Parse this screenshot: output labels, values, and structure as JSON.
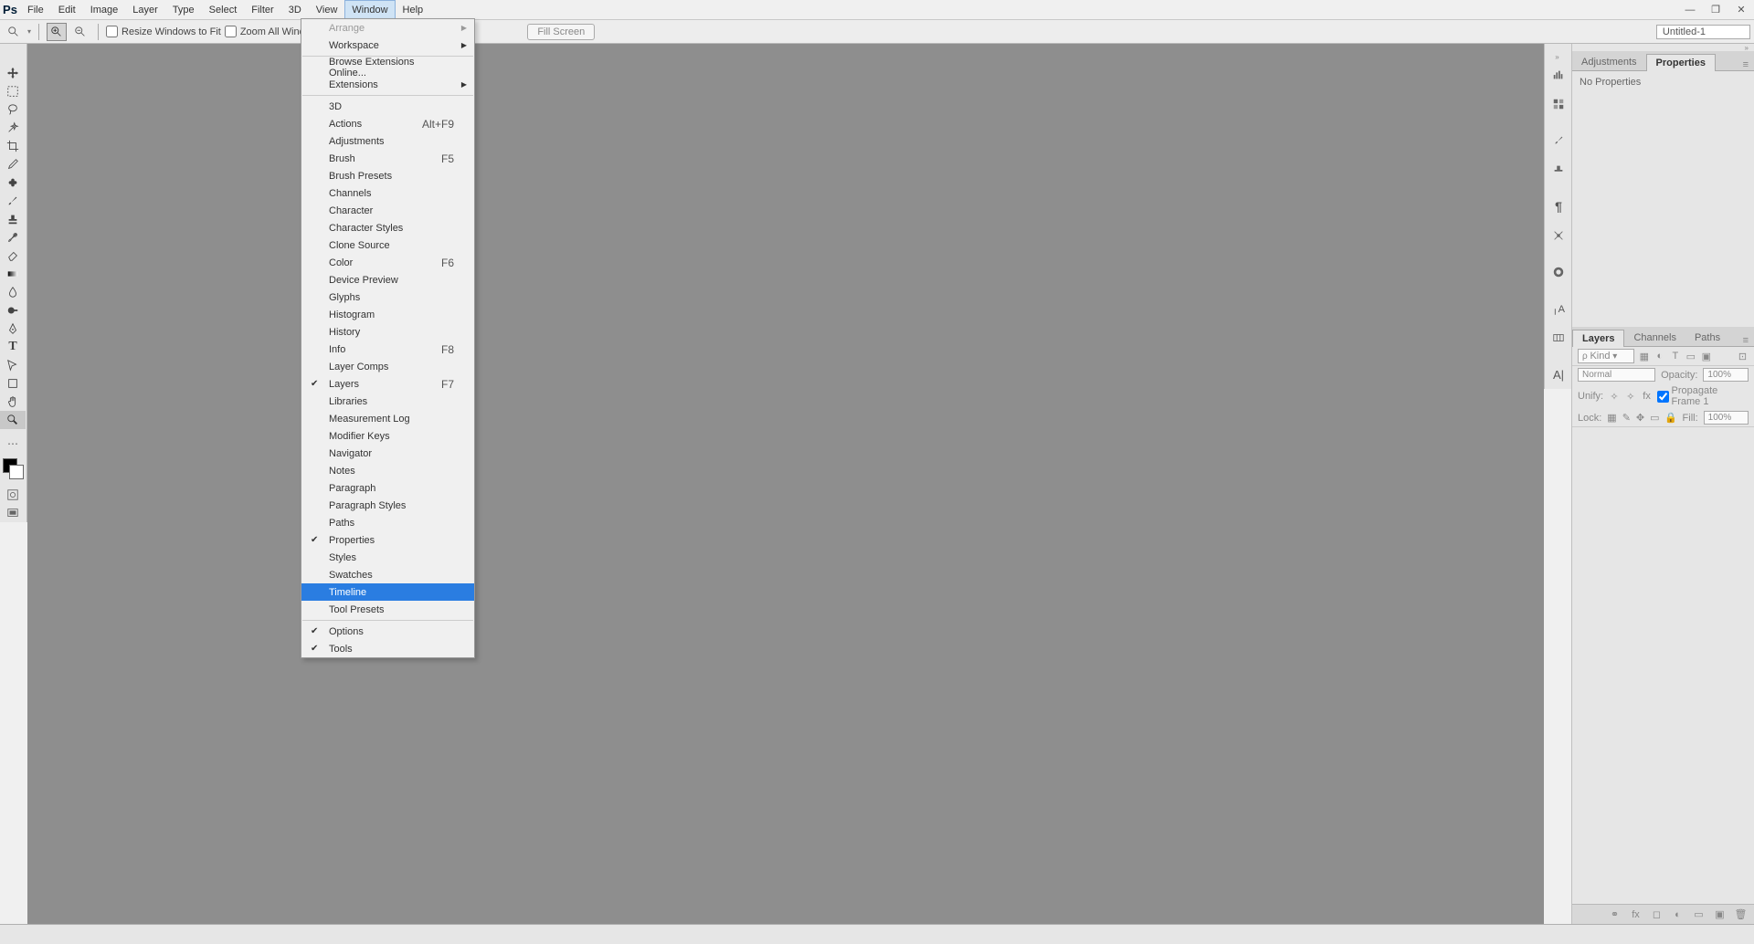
{
  "app": {
    "logo": "Ps"
  },
  "menubar": [
    "File",
    "Edit",
    "Image",
    "Layer",
    "Type",
    "Select",
    "Filter",
    "3D",
    "View",
    "Window",
    "Help"
  ],
  "active_menu": "Window",
  "window_controls": {
    "min": "—",
    "max": "❐",
    "close": "✕"
  },
  "optionsbar": {
    "resize_windows": "Resize Windows to Fit",
    "zoom_all": "Zoom All Windows",
    "fill_screen": "Fill Screen",
    "doc_name": "Untitled-1"
  },
  "dropdown": {
    "groups": [
      [
        {
          "label": "Arrange",
          "submenu": true,
          "disabled": true
        },
        {
          "label": "Workspace",
          "submenu": true
        }
      ],
      [
        {
          "label": "Browse Extensions Online..."
        },
        {
          "label": "Extensions",
          "submenu": true
        }
      ],
      [
        {
          "label": "3D"
        },
        {
          "label": "Actions",
          "shortcut": "Alt+F9"
        },
        {
          "label": "Adjustments"
        },
        {
          "label": "Brush",
          "shortcut": "F5"
        },
        {
          "label": "Brush Presets"
        },
        {
          "label": "Channels"
        },
        {
          "label": "Character"
        },
        {
          "label": "Character Styles"
        },
        {
          "label": "Clone Source"
        },
        {
          "label": "Color",
          "shortcut": "F6"
        },
        {
          "label": "Device Preview"
        },
        {
          "label": "Glyphs"
        },
        {
          "label": "Histogram"
        },
        {
          "label": "History"
        },
        {
          "label": "Info",
          "shortcut": "F8"
        },
        {
          "label": "Layer Comps"
        },
        {
          "label": "Layers",
          "shortcut": "F7",
          "checked": true
        },
        {
          "label": "Libraries"
        },
        {
          "label": "Measurement Log"
        },
        {
          "label": "Modifier Keys"
        },
        {
          "label": "Navigator"
        },
        {
          "label": "Notes"
        },
        {
          "label": "Paragraph"
        },
        {
          "label": "Paragraph Styles"
        },
        {
          "label": "Paths"
        },
        {
          "label": "Properties",
          "checked": true
        },
        {
          "label": "Styles"
        },
        {
          "label": "Swatches"
        },
        {
          "label": "Timeline",
          "highlighted": true
        },
        {
          "label": "Tool Presets"
        }
      ],
      [
        {
          "label": "Options",
          "checked": true
        },
        {
          "label": "Tools",
          "checked": true
        }
      ]
    ]
  },
  "properties_panel": {
    "tabs": [
      "Adjustments",
      "Properties"
    ],
    "active_tab": "Properties",
    "body": "No Properties"
  },
  "layers_panel": {
    "tabs": [
      "Layers",
      "Channels",
      "Paths"
    ],
    "active_tab": "Layers",
    "kind": "Kind",
    "blend": "Normal",
    "opacity_label": "Opacity:",
    "opacity_val": "100%",
    "unify": "Unify:",
    "propagate": "Propagate Frame 1",
    "lock": "Lock:",
    "fill_label": "Fill:",
    "fill_val": "100%"
  },
  "toolbar_tools": [
    "move",
    "marquee",
    "lasso",
    "wand",
    "crop",
    "eyedrop",
    "heal",
    "brush",
    "stamp",
    "history",
    "eraser",
    "gradient",
    "blur",
    "dodge",
    "pen",
    "type",
    "path",
    "shape",
    "hand",
    "zoom"
  ],
  "dock_icons": [
    "histogram",
    "swatches",
    "brush",
    "clone",
    "paragraph",
    "adjust",
    "cc",
    "char",
    "glyph",
    "tt"
  ]
}
